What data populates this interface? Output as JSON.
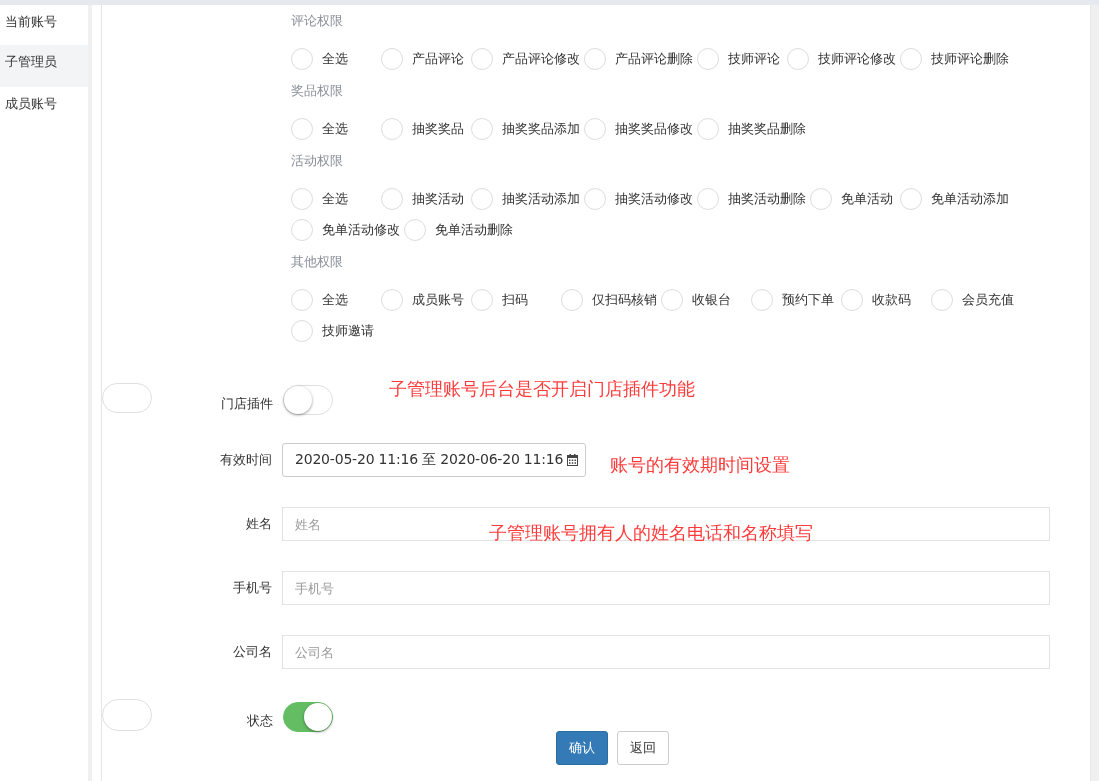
{
  "sidebar": {
    "items": [
      {
        "label": "当前账号",
        "selected": false
      },
      {
        "label": "子管理员",
        "selected": true
      },
      {
        "label": "成员账号",
        "selected": false
      }
    ]
  },
  "permission_groups": [
    {
      "title": "评论权限",
      "options": [
        {
          "label": "全选",
          "checked": false
        },
        {
          "label": "产品评论",
          "checked": false
        },
        {
          "label": "产品评论修改",
          "checked": false
        },
        {
          "label": "产品评论删除",
          "checked": false
        },
        {
          "label": "技师评论",
          "checked": false
        },
        {
          "label": "技师评论修改",
          "checked": false
        },
        {
          "label": "技师评论删除",
          "checked": false
        }
      ]
    },
    {
      "title": "奖品权限",
      "options": [
        {
          "label": "全选",
          "checked": false
        },
        {
          "label": "抽奖奖品",
          "checked": false
        },
        {
          "label": "抽奖奖品添加",
          "checked": false
        },
        {
          "label": "抽奖奖品修改",
          "checked": false
        },
        {
          "label": "抽奖奖品删除",
          "checked": false
        }
      ]
    },
    {
      "title": "活动权限",
      "options": [
        {
          "label": "全选",
          "checked": false
        },
        {
          "label": "抽奖活动",
          "checked": false
        },
        {
          "label": "抽奖活动添加",
          "checked": false
        },
        {
          "label": "抽奖活动修改",
          "checked": false
        },
        {
          "label": "抽奖活动删除",
          "checked": false
        },
        {
          "label": "免单活动",
          "checked": false
        },
        {
          "label": "免单活动添加",
          "checked": false
        },
        {
          "label": "免单活动修改",
          "checked": false
        },
        {
          "label": "免单活动删除",
          "checked": false
        }
      ]
    },
    {
      "title": "其他权限",
      "options": [
        {
          "label": "全选",
          "checked": false
        },
        {
          "label": "成员账号",
          "checked": false
        },
        {
          "label": "扫码",
          "checked": false
        },
        {
          "label": "仅扫码核销",
          "checked": false
        },
        {
          "label": "收银台",
          "checked": false
        },
        {
          "label": "预约下单",
          "checked": false
        },
        {
          "label": "收款码",
          "checked": false
        },
        {
          "label": "会员充值",
          "checked": false
        },
        {
          "label": "技师邀请",
          "checked": false
        }
      ]
    }
  ],
  "form_rows": [
    {
      "kind": "toggle",
      "label": "门店插件",
      "on": false,
      "annotation": "子管理账号后台是否开启门店插件功能"
    },
    {
      "kind": "daterange",
      "label": "有效时间",
      "value": "2020-05-20 11:16 至 2020-06-20 11:16",
      "annotation": "账号的有效期时间设置"
    },
    {
      "kind": "text",
      "label": "姓名",
      "placeholder": "姓名",
      "annotation": "子管理账号拥有人的姓名电话和名称填写"
    },
    {
      "kind": "text",
      "label": "手机号",
      "placeholder": "手机号"
    },
    {
      "kind": "text",
      "label": "公司名",
      "placeholder": "公司名"
    },
    {
      "kind": "toggle",
      "label": "状态",
      "on": true
    }
  ],
  "buttons": [
    {
      "label": "确认",
      "kind": "primary"
    },
    {
      "label": "返回",
      "kind": "default"
    }
  ]
}
